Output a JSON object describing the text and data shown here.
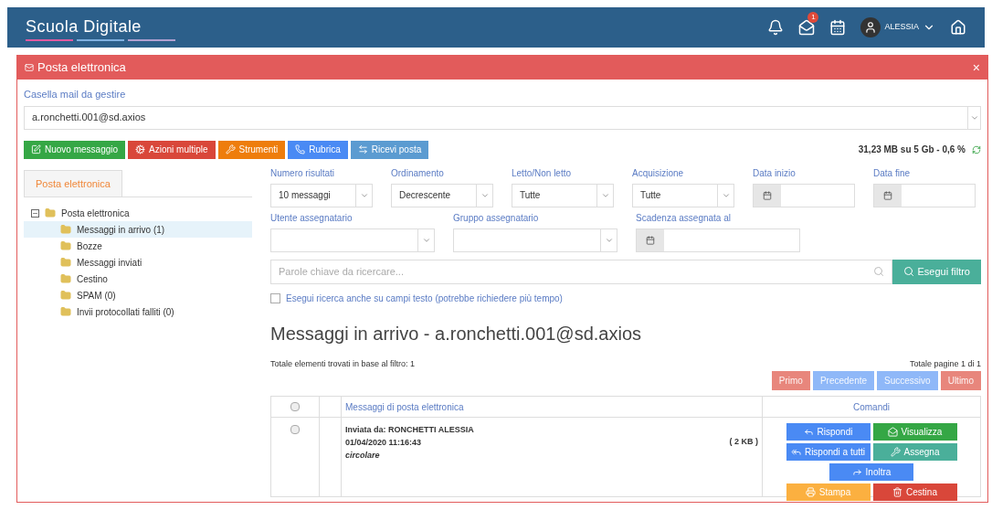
{
  "header": {
    "logo": "Scuola Digitale",
    "mail_badge": "1",
    "user": "ALESSIA"
  },
  "panel": {
    "title": "Posta elettronica",
    "close": "×"
  },
  "mailbox": {
    "label": "Casella mail da gestire",
    "value": "a.ronchetti.001@sd.axios"
  },
  "toolbar": [
    {
      "label": "Nuovo messaggio",
      "kind": "new",
      "color": "#35a745"
    },
    {
      "label": "Azioni multiple",
      "kind": "batch",
      "color": "#d9473a"
    },
    {
      "label": "Strumenti",
      "kind": "tools",
      "color": "#ee7d0c"
    },
    {
      "label": "Rubrica",
      "kind": "contacts",
      "color": "#4a8af4"
    },
    {
      "label": "Ricevi posta",
      "kind": "receive",
      "color": "#5b9bd1"
    }
  ],
  "quota": "31,23 MB su 5 Gb - 0,6 %",
  "sidebar": {
    "tab": {
      "label": "Posta elettronica",
      "selected": true
    },
    "tree": [
      {
        "label": "Posta elettronica",
        "expanded": true,
        "selected": false,
        "children": [
          {
            "label": "Messaggi in arrivo (1)",
            "selected": true
          },
          {
            "label": "Bozze",
            "selected": false
          },
          {
            "label": "Messaggi inviati",
            "selected": false
          },
          {
            "label": "Cestino",
            "selected": false
          },
          {
            "label": "SPAM (0)",
            "selected": false
          },
          {
            "label": "Invii protocollati falliti (0)",
            "selected": false
          }
        ]
      }
    ]
  },
  "filters": [
    {
      "label": "Numero risultati",
      "kind": "select",
      "value": "10 messaggi"
    },
    {
      "label": "Ordinamento",
      "kind": "select",
      "value": "Decrescente"
    },
    {
      "label": "Letto/Non letto",
      "kind": "select",
      "value": "Tutte"
    },
    {
      "label": "Acquisizione",
      "kind": "select",
      "value": "Tutte"
    },
    {
      "label": "Data inizio",
      "kind": "date"
    },
    {
      "label": "Data fine",
      "kind": "date"
    },
    {
      "label": "Utente assegnatario",
      "kind": "select"
    },
    {
      "label": "Gruppo assegnatario",
      "kind": "select"
    },
    {
      "label": "Scadenza assegnata al",
      "kind": "date"
    }
  ],
  "search": {
    "placeholder": "Parole chiave da ricercare...",
    "button": "Esegui filtro"
  },
  "fulltext": {
    "label": "Esegui ricerca anche su campi testo (potrebbe richiedere più tempo)",
    "checked": false
  },
  "heading": "Messaggi in arrivo - a.ronchetti.001@sd.axios",
  "total": "Totale elementi trovati in base al filtro: 1",
  "pages": "Totale pagine 1 di 1",
  "pagination": [
    {
      "label": "Primo",
      "color": "#e8867c",
      "disabled": true
    },
    {
      "label": "Precedente",
      "color": "#8fb8f8",
      "disabled": true
    },
    {
      "label": "Successivo",
      "color": "#8fb8f8",
      "disabled": true
    },
    {
      "label": "Ultimo",
      "color": "#e8867c",
      "disabled": true
    }
  ],
  "table": {
    "columns": [
      "Messaggi di posta elettronica",
      "Comandi"
    ],
    "header_checked": false,
    "rows": [
      {
        "checked": false,
        "from": "Inviata da: RONCHETTI ALESSIA",
        "date": "01/04/2020 11:16:43",
        "subject": "circolare",
        "size": "( 2 KB )",
        "commands": [
          [
            {
              "label": "Rispondi",
              "kind": "reply",
              "color": "#4a8af4"
            },
            {
              "label": "Visualizza",
              "kind": "view",
              "color": "#35a745"
            }
          ],
          [
            {
              "label": "Rispondi a tutti",
              "kind": "replyall",
              "color": "#4a8af4"
            },
            {
              "label": "Assegna",
              "kind": "assign",
              "color": "#4aaf9a"
            }
          ],
          [
            {
              "label": "Inoltra",
              "kind": "forward",
              "color": "#4a8af4"
            }
          ],
          [
            {
              "label": "Stampa",
              "kind": "print",
              "color": "#fbb040"
            },
            {
              "label": "Cestina",
              "kind": "trash",
              "color": "#d9473a"
            }
          ]
        ]
      }
    ]
  }
}
